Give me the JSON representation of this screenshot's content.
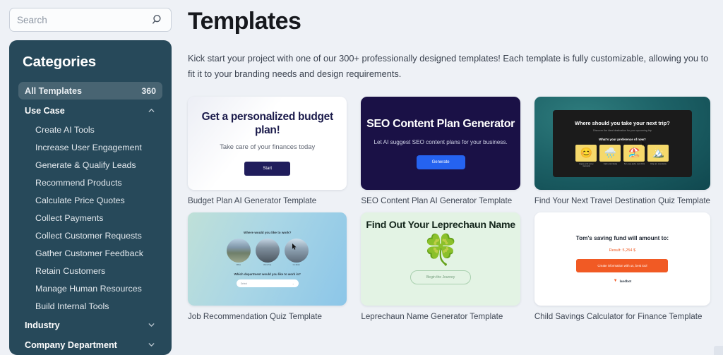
{
  "search": {
    "value": "",
    "placeholder": "Search",
    "icon": "search-icon"
  },
  "sidebar": {
    "title": "Categories",
    "all": {
      "label": "All Templates",
      "count": "360"
    },
    "groups": [
      {
        "label": "Use Case",
        "expanded": true,
        "icon": "chevron-up-icon",
        "items": [
          {
            "label": "Create AI Tools"
          },
          {
            "label": "Increase User Engagement"
          },
          {
            "label": "Generate & Qualify Leads"
          },
          {
            "label": "Recommend Products"
          },
          {
            "label": "Calculate Price Quotes"
          },
          {
            "label": "Collect Payments"
          },
          {
            "label": "Collect Customer Requests"
          },
          {
            "label": "Gather Customer Feedback"
          },
          {
            "label": "Retain Customers"
          },
          {
            "label": "Manage Human Resources"
          },
          {
            "label": "Build Internal Tools"
          }
        ]
      },
      {
        "label": "Industry",
        "expanded": false,
        "icon": "chevron-down-icon",
        "items": []
      },
      {
        "label": "Company Department",
        "expanded": false,
        "icon": "chevron-down-icon",
        "items": []
      }
    ]
  },
  "main": {
    "title": "Templates",
    "description": "Kick start your project with one of our 300+ professionally designed templates! Each template is fully customizable, allowing you to fit it to your branding needs and design requirements.",
    "cards": [
      {
        "caption": "Budget Plan AI Generator  Template",
        "preview": {
          "heading": "Get a personalized budget plan!",
          "subheading": "Take care of your finances today",
          "button": "Start"
        }
      },
      {
        "caption": "SEO Content Plan AI Generator  Template",
        "preview": {
          "heading": "SEO Content Plan Generator",
          "subheading": "Let AI suggest SEO content plans for your business.",
          "button": "Generate"
        }
      },
      {
        "caption": "Find Your Next Travel Destination Quiz  Template",
        "preview": {
          "heading": "Where should you take your next trip?",
          "subheading": "Discover the ideal destination for your upcoming trip",
          "question": "What's your preference of now?",
          "options": [
            {
              "emoji": "😊",
              "label": "Happy and sunny moments"
            },
            {
              "emoji": "🌧️",
              "label": "Calm and cloudy"
            },
            {
              "emoji": "🏖️",
              "label": "Sun, sea and a cool drink"
            },
            {
              "emoji": "🏔️",
              "label": "Crisp air, mountains"
            }
          ]
        }
      },
      {
        "caption": "Job Recommendation Quiz  Template",
        "preview": {
          "question1": "Where would you like to work?",
          "circles": [
            {
              "label": "Office"
            },
            {
              "label": "Work Trip"
            },
            {
              "label": "Co-Work"
            }
          ],
          "question2": "Which department would you like to work in?",
          "select_value": "Select"
        }
      },
      {
        "caption": "Leprechaun Name Generator  Template",
        "preview": {
          "heading": "Find Out Your Leprechaun Name",
          "art": "🍀",
          "button": "Begin the Journey"
        }
      },
      {
        "caption": "Child Savings Calculator for Finance  Template",
        "preview": {
          "heading": "Tom's saving fund will amount to:",
          "result": "Result: 5,254 $",
          "button": "Create information with us, best tool",
          "brand": "landbot"
        }
      }
    ]
  },
  "colors": {
    "sidebar_bg": "#27495a",
    "page_bg": "#eef1f6",
    "accent_blue": "#2563f0",
    "accent_orange": "#f15a24",
    "navy": "#1a1146"
  }
}
